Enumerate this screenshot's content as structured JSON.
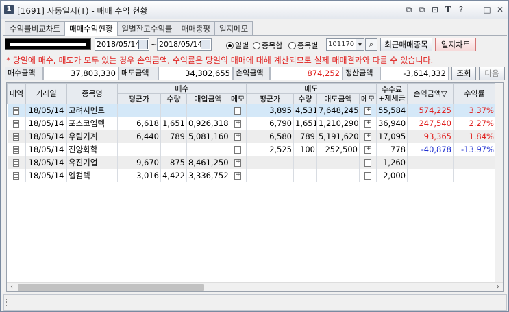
{
  "window": {
    "num": "1",
    "title": "[1691] 자동일지(T) - 매매 수익 현황"
  },
  "title_icons": [
    "restore-tile-icon",
    "copy-window-icon",
    "pin-icon",
    "font-size-icon",
    "help-icon",
    "minimize-icon",
    "maximize-icon",
    "close-icon"
  ],
  "title_glyphs": {
    "restore": "⧉",
    "copy": "⧉",
    "pin": "⊡",
    "font": "T",
    "help": "?",
    "min": "—",
    "max": "□",
    "close": "✕"
  },
  "tabs": [
    {
      "label": "수익률비교차트",
      "active": false
    },
    {
      "label": "매매수익현황",
      "active": true
    },
    {
      "label": "일별잔고수익률",
      "active": false
    },
    {
      "label": "매매총평",
      "active": false
    },
    {
      "label": "일지메모",
      "active": false
    }
  ],
  "controls": {
    "date_from": "2018/05/14",
    "date_to": "2018/05/14",
    "tilde": "~",
    "radio": [
      {
        "label": "일별",
        "checked": true
      },
      {
        "label": "종목합",
        "checked": false
      },
      {
        "label": "종목별",
        "checked": false
      }
    ],
    "code": "101170",
    "recent_btn": "최근매매종목",
    "chart_btn": "일지차트"
  },
  "notice": "* 당일에 매수, 매도가 모두 있는 경우 손익금액, 수익률은 당일의 매매에 대해 계산되므로 실제 매매결과와 다를 수 있습니다.",
  "summary": {
    "buy_label": "매수금액",
    "buy_value": "37,803,330",
    "sell_label": "매도금액",
    "sell_value": "34,302,655",
    "pl_label": "손익금액",
    "pl_value": "874,252",
    "settle_label": "정산금액",
    "settle_value": "-3,614,332",
    "query_btn": "조회",
    "next_btn": "다음"
  },
  "table": {
    "headers": {
      "kind": "내역",
      "date": "거래일",
      "name": "종목명",
      "buy_group": "매수",
      "sell_group": "매도",
      "fee1": "수수료",
      "fee2": "+제세금",
      "pl": "손익금액▽",
      "rate": "수익률",
      "avg": "평균가",
      "qty": "수량",
      "buy_amt": "매입금액",
      "memo": "메모",
      "sell_amt": "매도금액"
    },
    "rows": [
      {
        "date": "18/05/14",
        "name": "고려시멘트",
        "b_avg": "",
        "b_qty": "",
        "b_amt": "",
        "b_memo": "",
        "s_avg": "3,895",
        "s_qty": "4,531",
        "s_amt": "7,648,245",
        "s_memo": "plus",
        "fee": "55,584",
        "pl": "574,225",
        "rate": "3.37%",
        "sign": "pos",
        "selected": true
      },
      {
        "date": "18/05/14",
        "name": "포스코엠텍",
        "b_avg": "6,618",
        "b_qty": "1,651",
        "b_amt": "0,926,318",
        "b_memo": "plus",
        "s_avg": "6,790",
        "s_qty": "1,651",
        "s_amt": "1,210,290",
        "s_memo": "plus",
        "fee": "36,940",
        "pl": "247,540",
        "rate": "2.27%",
        "sign": "pos",
        "selected": false
      },
      {
        "date": "18/05/14",
        "name": "우림기계",
        "b_avg": "6,440",
        "b_qty": "789",
        "b_amt": "5,081,160",
        "b_memo": "plus",
        "s_avg": "6,580",
        "s_qty": "789",
        "s_amt": "5,191,620",
        "s_memo": "plus",
        "fee": "17,095",
        "pl": "93,365",
        "rate": "1.84%",
        "sign": "pos",
        "selected": false
      },
      {
        "date": "18/05/14",
        "name": "진양화학",
        "b_avg": "",
        "b_qty": "",
        "b_amt": "",
        "b_memo": "",
        "s_avg": "2,525",
        "s_qty": "100",
        "s_amt": "252,500",
        "s_memo": "plus",
        "fee": "778",
        "pl": "-40,878",
        "rate": "-13.97%",
        "sign": "neg",
        "selected": false
      },
      {
        "date": "18/05/14",
        "name": "유진기업",
        "b_avg": "9,670",
        "b_qty": "875",
        "b_amt": "8,461,250",
        "b_memo": "plus",
        "s_avg": "",
        "s_qty": "",
        "s_amt": "",
        "s_memo": "",
        "fee": "1,260",
        "pl": "",
        "rate": "",
        "sign": "",
        "selected": false
      },
      {
        "date": "18/05/14",
        "name": "엘컴텍",
        "b_avg": "3,016",
        "b_qty": "4,422",
        "b_amt": "3,336,752",
        "b_memo": "plus",
        "s_avg": "",
        "s_qty": "",
        "s_amt": "",
        "s_memo": "",
        "fee": "2,000",
        "pl": "",
        "rate": "",
        "sign": "",
        "selected": false
      }
    ]
  },
  "colors": {
    "positive": "#e0201e",
    "negative": "#2030d0",
    "selected_row": "#d4e8f8"
  }
}
